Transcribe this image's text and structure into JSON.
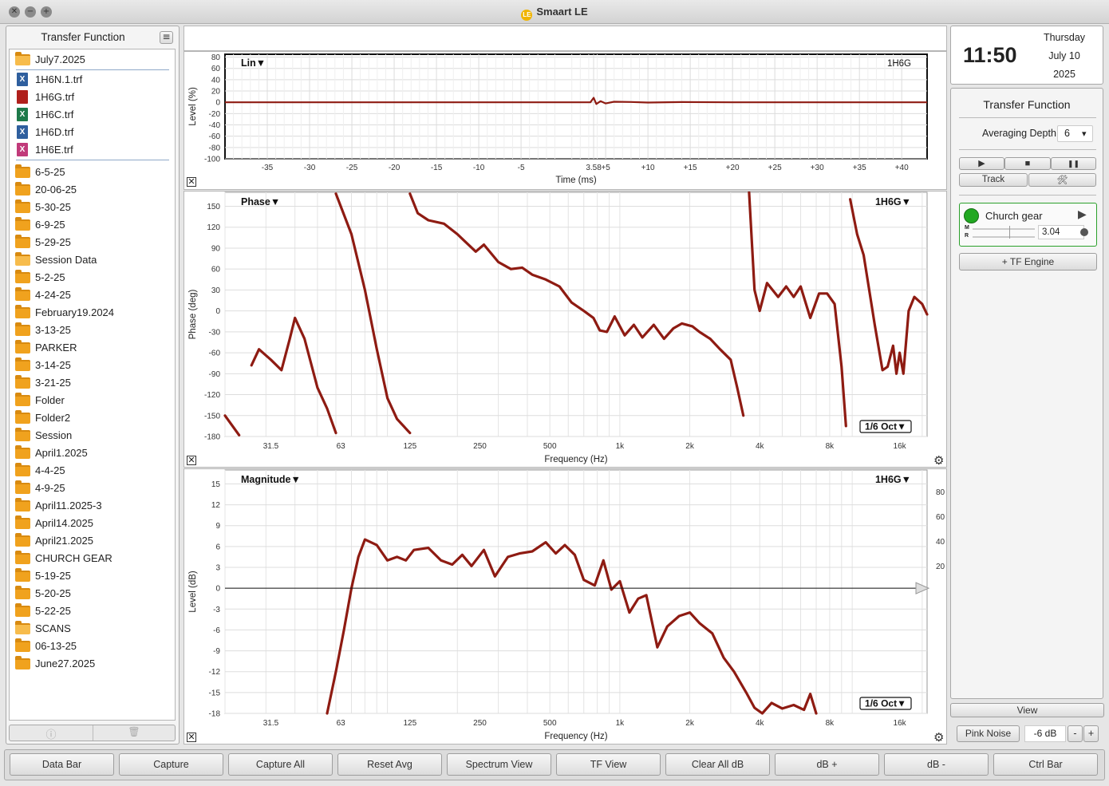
{
  "window": {
    "title": "Smaart LE",
    "logo_text": "LE",
    "close_glyph": "✕",
    "minimize_glyph": "−",
    "zoom_glyph": "+"
  },
  "sidebar": {
    "header": "Transfer Function",
    "menu_glyph": "≡",
    "open_folder": "July7.2025",
    "files": [
      {
        "label": "1H6N.1.trf",
        "color": "#2f5f9e",
        "glyph": "X"
      },
      {
        "label": "1H6G.trf",
        "color": "#b0201c",
        "glyph": ""
      },
      {
        "label": "1H6C.trf",
        "color": "#1e7a4a",
        "glyph": "X"
      },
      {
        "label": "1H6D.trf",
        "color": "#2f5f9e",
        "glyph": "X"
      },
      {
        "label": "1H6E.trf",
        "color": "#c13a7a",
        "glyph": "X"
      }
    ],
    "folders": [
      {
        "label": "6-5-25",
        "open": false
      },
      {
        "label": "20-06-25",
        "open": false
      },
      {
        "label": "5-30-25",
        "open": false
      },
      {
        "label": "6-9-25",
        "open": false
      },
      {
        "label": "5-29-25",
        "open": false
      },
      {
        "label": "Session Data",
        "open": true
      },
      {
        "label": "5-2-25",
        "open": false
      },
      {
        "label": "4-24-25",
        "open": false
      },
      {
        "label": "February19.2024",
        "open": false
      },
      {
        "label": "3-13-25",
        "open": false
      },
      {
        "label": "PARKER",
        "open": false
      },
      {
        "label": "3-14-25",
        "open": false
      },
      {
        "label": "3-21-25",
        "open": false
      },
      {
        "label": "Folder",
        "open": false
      },
      {
        "label": "Folder2",
        "open": false
      },
      {
        "label": "Session",
        "open": false
      },
      {
        "label": "April1.2025",
        "open": false
      },
      {
        "label": "4-4-25",
        "open": false
      },
      {
        "label": "4-9-25",
        "open": false
      },
      {
        "label": "April11.2025-3",
        "open": false
      },
      {
        "label": "April14.2025",
        "open": false
      },
      {
        "label": "April21.2025",
        "open": false
      },
      {
        "label": "CHURCH GEAR",
        "open": false
      },
      {
        "label": "5-19-25",
        "open": false
      },
      {
        "label": "5-20-25",
        "open": false
      },
      {
        "label": "5-22-25",
        "open": false
      },
      {
        "label": "SCANS",
        "open": true
      },
      {
        "label": "06-13-25",
        "open": false
      },
      {
        "label": "June27.2025",
        "open": false
      }
    ],
    "info_glyph": "ⓘ",
    "trash_glyph": "🗑"
  },
  "time_plot": {
    "title": "Lin▼",
    "trace_name": "1H6G",
    "ylabel": "Level (%)",
    "xlabel": "Time (ms)",
    "y_ticks": [
      "80",
      "60",
      "40",
      "20",
      "0",
      "-20",
      "-40",
      "-60",
      "-80",
      "-100"
    ],
    "x_ticks": [
      "-35",
      "-30",
      "-25",
      "-20",
      "-15",
      "-10",
      "-5",
      "3.58",
      "+5",
      "+10",
      "+15",
      "+20",
      "+25",
      "+30",
      "+35",
      "+40"
    ],
    "close_glyph": "✕"
  },
  "phase_plot": {
    "title": "Phase▼",
    "trace_name": "1H6G▼",
    "ylabel": "Phase (deg)",
    "xlabel": "Frequency (Hz)",
    "smoothing": "1/6 Oct▼",
    "y_ticks": [
      "150",
      "120",
      "90",
      "60",
      "30",
      "0",
      "-30",
      "-60",
      "-90",
      "-120",
      "-150",
      "-180"
    ],
    "x_ticks": [
      "31.5",
      "63",
      "125",
      "250",
      "500",
      "1k",
      "2k",
      "4k",
      "8k",
      "16k"
    ],
    "close_glyph": "✕",
    "gear_glyph": "⚙"
  },
  "magnitude_plot": {
    "title": "Magnitude▼",
    "trace_name": "1H6G▼",
    "ylabel": "Level (dB)",
    "xlabel": "Frequency (Hz)",
    "smoothing": "1/6 Oct▼",
    "y_ticks": [
      "15",
      "12",
      "9",
      "6",
      "3",
      "0",
      "-3",
      "-6",
      "-9",
      "-12",
      "-15",
      "-18"
    ],
    "right_ticks": [
      "80",
      "60",
      "40",
      "20"
    ],
    "x_ticks": [
      "31.5",
      "63",
      "125",
      "250",
      "500",
      "1k",
      "2k",
      "4k",
      "8k",
      "16k"
    ],
    "close_glyph": "✕",
    "gear_glyph": "⚙"
  },
  "clock": {
    "time": "11:50",
    "weekday": "Thursday",
    "date": "July 10",
    "year": "2025"
  },
  "control": {
    "title": "Transfer Function",
    "averaging_label": "Averaging Depth:",
    "averaging_value": "6",
    "dropdown_glyph": "▾",
    "play_glyph": "▶",
    "stop_glyph": "■",
    "pause_glyph": "❚❚",
    "track_label": "Track",
    "tools_glyph": "🛠",
    "engine": {
      "name": "Church gear",
      "meter_m": "M",
      "meter_r": "R",
      "delay_value": "3.04",
      "arrow_glyph": "▶",
      "status_color": "#22a822"
    },
    "add_engine_label": "+ TF Engine",
    "view_label": "View",
    "pink_noise_label": "Pink Noise",
    "noise_level": "-6 dB",
    "minus_label": "-",
    "plus_label": "+"
  },
  "bottom_bar": [
    "Data Bar",
    "Capture",
    "Capture All",
    "Reset Avg",
    "Spectrum View",
    "TF View",
    "Clear All dB",
    "dB +",
    "dB -",
    "Ctrl Bar"
  ],
  "chart_data": [
    {
      "type": "line",
      "name": "time",
      "xlabel": "Time (ms)",
      "ylabel": "Level (%)",
      "xlim": [
        -40,
        43
      ],
      "ylim": [
        -100,
        85
      ],
      "series": [
        {
          "x": [
            -40,
            0,
            3.2,
            3.58,
            3.9,
            4.4,
            5,
            6,
            8,
            10,
            14,
            20,
            43
          ],
          "y": [
            0,
            0,
            0,
            8,
            -3,
            2,
            -2,
            1,
            0.6,
            -0.5,
            0.4,
            0,
            0
          ]
        }
      ]
    },
    {
      "type": "line",
      "name": "phase",
      "xlabel": "Frequency (Hz)",
      "ylabel": "Phase (deg)",
      "x_scale": "log",
      "xlim": [
        20,
        21000
      ],
      "ylim": [
        -180,
        170
      ],
      "series": [
        {
          "x": [
            20,
            23
          ],
          "y": [
            -150,
            -178
          ]
        },
        {
          "x": [
            26,
            28,
            31.5,
            35,
            38,
            40,
            44,
            50,
            55,
            60
          ],
          "y": [
            -78,
            -55,
            -70,
            -85,
            -40,
            -10,
            -40,
            -110,
            -140,
            -175
          ]
        },
        {
          "x": [
            60,
            70,
            80,
            90,
            100,
            110,
            125
          ],
          "y": [
            168,
            110,
            30,
            -55,
            -125,
            -155,
            -175
          ]
        },
        {
          "x": [
            125,
            135,
            150,
            175,
            200,
            215,
            240,
            260,
            300,
            340,
            380,
            420,
            480,
            550,
            620,
            700,
            770,
            820,
            880,
            950,
            1050,
            1150,
            1250,
            1400,
            1550,
            1700,
            1850,
            2050,
            2200,
            2450,
            2700,
            3000,
            3200,
            3400
          ],
          "y": [
            168,
            140,
            130,
            125,
            110,
            100,
            85,
            95,
            70,
            60,
            62,
            52,
            45,
            35,
            12,
            0,
            -10,
            -28,
            -30,
            -8,
            -35,
            -20,
            -38,
            -20,
            -40,
            -25,
            -18,
            -22,
            -30,
            -40,
            -55,
            -70,
            -110,
            -150
          ]
        },
        {
          "x": [
            3600.0,
            3800.0,
            4000.0,
            4300.0,
            4800.0,
            5200.0,
            5600.0,
            6000.0,
            6600.0,
            7200.0,
            7800.0,
            8400.0,
            9000.0,
            9400.0
          ],
          "y": [
            170,
            30,
            0,
            40,
            20,
            35,
            20,
            35,
            -10,
            25,
            25,
            10,
            -80,
            -165
          ]
        },
        {
          "x": [
            9800.0,
            10500.0,
            11200.0,
            12500.0,
            13500.0,
            14200.0,
            15000.0,
            15500.0,
            16000.0,
            16600.0,
            17500.0,
            18500.0,
            20000.0,
            21000.0
          ],
          "y": [
            160,
            110,
            80,
            -20,
            -85,
            -80,
            -50,
            -90,
            -60,
            -90,
            0,
            20,
            10,
            -5
          ]
        }
      ]
    },
    {
      "type": "line",
      "name": "magnitude",
      "xlabel": "Frequency (Hz)",
      "ylabel": "Level (dB)",
      "x_scale": "log",
      "xlim": [
        20,
        21000
      ],
      "ylim": [
        -18,
        17
      ],
      "series": [
        {
          "x": [
            55,
            60,
            65,
            70,
            75,
            80,
            90,
            100,
            110,
            120,
            130,
            150,
            170,
            190,
            210,
            230,
            260,
            290,
            330,
            370,
            420,
            480,
            530,
            580,
            640,
            700,
            780,
            850,
            920,
            1000,
            1100,
            1200,
            1300,
            1450,
            1600,
            1800,
            2000,
            2200,
            2500,
            2800,
            3100,
            3500,
            3800,
            4100,
            4500,
            5000,
            5600,
            6200,
            6600,
            7000
          ],
          "y": [
            -18,
            -12,
            -6,
            0,
            4.5,
            7,
            6.2,
            4,
            4.5,
            4,
            5.5,
            5.8,
            4,
            3.4,
            4.8,
            3.2,
            5.5,
            1.7,
            4.5,
            5.0,
            5.3,
            6.6,
            5.0,
            6.2,
            4.8,
            1.2,
            0.4,
            4.0,
            -0.2,
            1.0,
            -3.5,
            -1.5,
            -1.0,
            -8.5,
            -5.5,
            -4.0,
            -3.5,
            -5.0,
            -6.5,
            -10.0,
            -12.0,
            -15.0,
            -17.2,
            -18.0,
            -16.5,
            -17.3,
            -16.8,
            -17.5,
            -15.2,
            -18.0
          ]
        }
      ]
    }
  ]
}
